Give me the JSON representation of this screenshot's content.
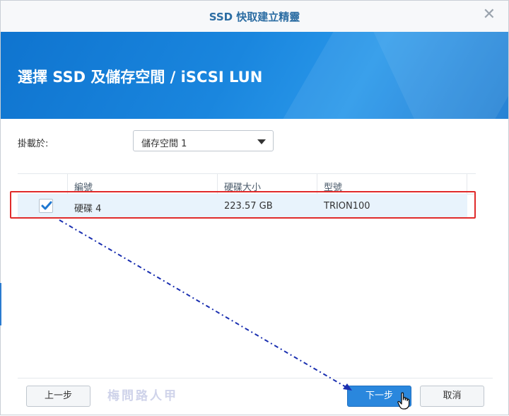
{
  "dialog": {
    "title": "SSD 快取建立精靈",
    "close_symbol": "✕",
    "heading": "選擇 SSD 及儲存空間 / iSCSI LUN"
  },
  "mount": {
    "label": "掛載於:",
    "selected": "儲存空間 1"
  },
  "table": {
    "columns": [
      "編號",
      "硬碟大小",
      "型號"
    ],
    "rows": [
      {
        "checked": true,
        "id": "硬碟 4",
        "size": "223.57 GB",
        "model": "TRION100"
      }
    ]
  },
  "buttons": {
    "prev": "上一步",
    "next": "下一步",
    "cancel": "取消"
  },
  "watermark": "梅問路人甲",
  "colors": {
    "accent": "#2a87dd",
    "title": "#2c6da3",
    "highlight": "#e02b2b",
    "annotation_arrow": "#1a2fb0"
  }
}
